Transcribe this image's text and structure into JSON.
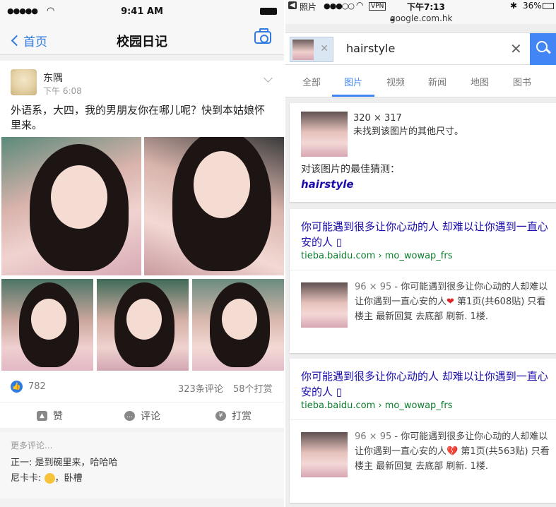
{
  "left": {
    "status": {
      "signal": "●●●●●",
      "time": "9:41 AM"
    },
    "nav": {
      "back": "首页",
      "title": "校园日记"
    },
    "post": {
      "user": "东隅",
      "time": "下午 6:08",
      "text": "外语系，大四，我的男朋友你在哪儿呢？快到本姑娘怀里来。",
      "likes": "782",
      "comments_count": "323条评论",
      "tips_count": "58个打赏"
    },
    "actions": {
      "like": "赞",
      "comment": "评论",
      "tip": "打赏"
    },
    "comments": {
      "more": "更多评论...",
      "items": [
        {
          "user": "正一",
          "text": "是到碗里来，哈哈哈"
        },
        {
          "user": "尼卡卡",
          "text": "，卧槽"
        }
      ]
    }
  },
  "right": {
    "status": {
      "back_app": "照片",
      "signal": "●●●○○",
      "vpn": "VPN",
      "time": "下午7:13",
      "battery": "36%",
      "url": "google.com.hk"
    },
    "search": {
      "query": "hairstyle"
    },
    "tabs": [
      "全部",
      "图片",
      "视频",
      "新闻",
      "地图",
      "图书"
    ],
    "active_tab": 1,
    "info": {
      "size": "320 × 317",
      "no_other": "未找到该图片的其他尺寸。",
      "best_guess_label": "对该图片的最佳猜测：",
      "best_guess": "hairstyle"
    },
    "results": [
      {
        "title": "你可能遇到很多让你心动的人 却难以让你遇到一直心安的人 ▯",
        "url": "tieba.baidu.com › mo_wowap_frs",
        "dims": "96 × 95",
        "snippet_a": " - 你可能遇到很多让你心动的人却难以让你遇到一直心安的人",
        "snippet_b": " 第1页(共608贴) 只看楼主 最新回复 去底部 刷新. 1楼."
      },
      {
        "title": "你可能遇到很多让你心动的人 却难以让你遇到一直心安的人 ▯",
        "url": "tieba.baidu.com › mo_wowap_frs",
        "dims": "96 × 95",
        "snippet_a": " - 你可能遇到很多让你心动的人却难以让你遇到一直心安的人",
        "snippet_b": " 第1页(共563贴) 只看楼主 最新回复 去底部 刷新. 1楼."
      }
    ]
  }
}
